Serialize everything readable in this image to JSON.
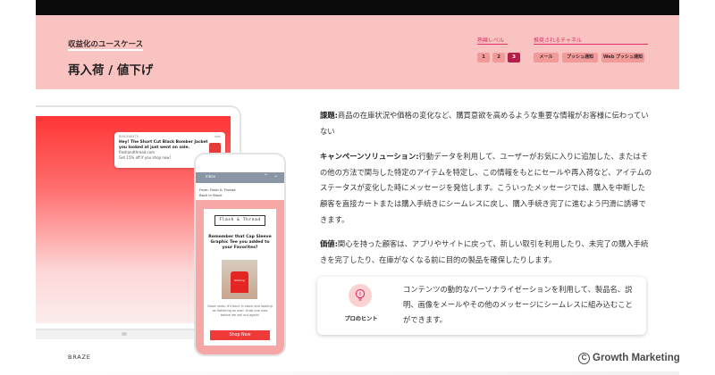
{
  "header": {
    "usecase_label": "収益化のユースケース",
    "title": "再入荷 / 値下げ",
    "skill_level_label": "熟練レベル",
    "levels": [
      "1",
      "2",
      "3"
    ],
    "active_level": "3",
    "channels_label": "推奨されるチャネル",
    "channels": [
      "メール",
      "プッシュ通知",
      "Web プッシュ通知"
    ]
  },
  "notification": {
    "app": "BRICKABYTE",
    "time": "now",
    "title": "Hey! The Short Cut Black Bomber Jacket you looked at just went on sale.",
    "url": "flashandthread.com",
    "body": "Get 15% off if you shop now!"
  },
  "phone": {
    "inbox": "Inbox",
    "from": "From: Flash & Thread",
    "subject": "Back in Stock",
    "brand": "Flash & Thread",
    "headline": "Remember that Cap Sleeve Graphic Tee you added to your Favorites?",
    "shirt_text": "Nothing",
    "body": "Good news: it's back in stock and looking as flattering as ever. Grab one now before we sell out again!",
    "cta": "Shop Now"
  },
  "content": {
    "issue_label": "課題:",
    "issue_text": "商品の在庫状況や価格の変化など、購買意欲を高めるような重要な情報がお客様に伝わっていない",
    "solution_label": "キャンペーンソリューション:",
    "solution_text": "行動データを利用して、ユーザーがお気に入りに追加した、またはその他の方法で関与した特定のアイテムを特定し、この情報をもとにセールや再入荷など、アイテムのステータスが変化した時にメッセージを発信します。こういったメッセージでは、購入を中断した顧客を直接カートまたは購入手続きにシームレスに戻し、購入手続き完了に進むよう円滑に誘導できます。",
    "value_label": "価値:",
    "value_text": "関心を持った顧客は、アプリやサイトに戻って、新しい取引を利用したり、未完了の購入手続きを完了したり、在庫がなくなる前に目的の製品を確保したりします。"
  },
  "tip": {
    "label": "プロのヒント",
    "icon": "lightbulb-icon",
    "text": "コンテンツの動的なパーソナライゼーションを利用して、製品名、説明、画像をメールやその他のメッセージにシームレスに組み込むことができます。"
  },
  "footer": {
    "left": "BRAZE",
    "brand": "Growth Marketing",
    "brand_mark": "C"
  },
  "colors": {
    "header_bg": "#f8c3c0",
    "accent": "#e0306a",
    "active_level": "#b51d4a",
    "cta": "#f03a3a"
  }
}
